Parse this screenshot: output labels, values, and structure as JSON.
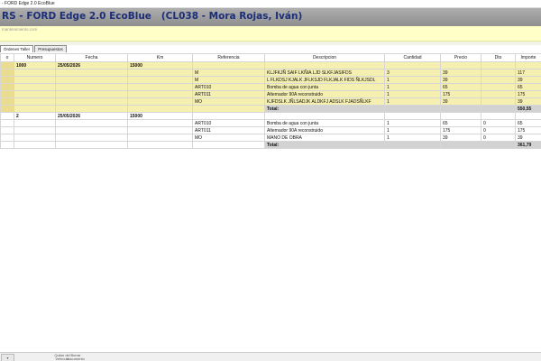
{
  "window": {
    "title": "- FORD Edge 2.0 EcoBlue"
  },
  "header": {
    "text": "RS - FORD Edge 2.0 EcoBlue   (CL038 - Mora Rojas, Iván)"
  },
  "ybar": {
    "link": "mantenimiento.com"
  },
  "tabs": [
    {
      "label": "Órdenes Taller"
    },
    {
      "label": "Presupuestos"
    }
  ],
  "grid": {
    "columns": [
      "o",
      "Numero",
      "Fecha",
      "Km",
      "Referencia",
      "Descripcion",
      "Cantidad",
      "Precio",
      "Dto",
      "Importe"
    ],
    "blocks": [
      {
        "numero": "1000",
        "fecha": "25/05/2026",
        "km": "15000",
        "style": "y",
        "lines": [
          {
            "ref": "M",
            "desc": "KLJFKJÑ SAIF LKÑIA LJD SLKFJASIFDS",
            "cant": "3",
            "precio": "39",
            "dto": "",
            "importe": "117"
          },
          {
            "ref": "M",
            "desc": "L FLKDSJ KJALK JFLKSJD FLKJALK FIDS ÑLKJSDL",
            "cant": "1",
            "precio": "39",
            "dto": "",
            "importe": "39"
          },
          {
            "ref": "ART010",
            "desc": "Bomba de agua con junta",
            "cant": "1",
            "precio": "65",
            "dto": "",
            "importe": "65"
          },
          {
            "ref": "ART011",
            "desc": "Alternador 90A reconstruido",
            "cant": "1",
            "precio": "175",
            "dto": "",
            "importe": "175"
          },
          {
            "ref": "MO",
            "desc": "KJFDSLK JÑLSADJK ALDKFJ ADSLK FJADSÑLKF",
            "cant": "1",
            "precio": "39",
            "dto": "",
            "importe": "39"
          }
        ],
        "total_label": "Total:",
        "total_value": "550,55"
      },
      {
        "numero": "2",
        "fecha": "25/05/2026",
        "km": "15000",
        "style": "w",
        "lines": [
          {
            "ref": "ART010",
            "desc": "Bomba de agua con junta",
            "cant": "1",
            "precio": "65",
            "dto": "0",
            "importe": "65"
          },
          {
            "ref": "ART011",
            "desc": "Alternador 90A reconstruido",
            "cant": "1",
            "precio": "175",
            "dto": "0",
            "importe": "175"
          },
          {
            "ref": "MO",
            "desc": "MANO DE OBRA",
            "cant": "1",
            "precio": "39",
            "dto": "0",
            "importe": "39"
          }
        ],
        "total_label": "Total:",
        "total_value": "361,79"
      }
    ]
  },
  "bottombar": {
    "buttons": [
      {
        "label": "Quitar del\nVehículo"
      },
      {
        "label": "Borrar\ndocumento"
      }
    ]
  },
  "colors": {
    "header_text": "#1c2e7a",
    "yellow_bar": "#ffffc8",
    "row_yellow": "#f5efb0",
    "total_gray": "#d2d2d2"
  }
}
